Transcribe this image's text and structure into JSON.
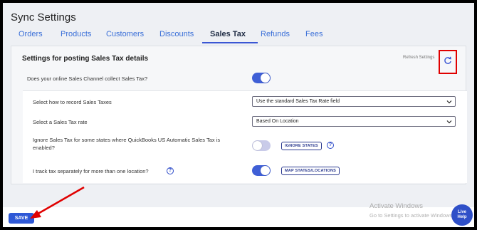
{
  "page": {
    "title": "Sync Settings"
  },
  "tabs": [
    {
      "label": "Orders"
    },
    {
      "label": "Products"
    },
    {
      "label": "Customers"
    },
    {
      "label": "Discounts"
    },
    {
      "label": "Sales Tax",
      "active": true
    },
    {
      "label": "Refunds"
    },
    {
      "label": "Fees"
    }
  ],
  "section": {
    "heading": "Settings for posting Sales Tax details",
    "refresh_label": "Refresh Settings",
    "refresh_icon": "refresh-icon"
  },
  "settings": {
    "collect_tax": {
      "label": "Does your online Sales Channel collect Sales Tax?",
      "enabled": true
    },
    "record_method": {
      "label": "Select how to record Sales Taxes",
      "value": "Use the standard Sales Tax Rate field"
    },
    "tax_rate": {
      "label": "Select a Sales Tax rate",
      "value": "Based On Location"
    },
    "ignore_states": {
      "label": "Ignore Sales Tax for some states where QuickBooks US Automatic Sales Tax is enabled?",
      "enabled": false,
      "button": "IGNORE STATES"
    },
    "track_locations": {
      "label": "I track tax separately for more than one location?",
      "enabled": true,
      "button": "MAP STATES/LOCATIONS"
    }
  },
  "footer": {
    "save_label": "SAVE"
  },
  "watermark": {
    "line1": "Activate Windows",
    "line2": "Go to Settings to activate Windows."
  },
  "live_help": {
    "line1": "Live",
    "line2": "Help"
  },
  "colors": {
    "accent": "#2e58d6",
    "highlight": "#e00000"
  }
}
